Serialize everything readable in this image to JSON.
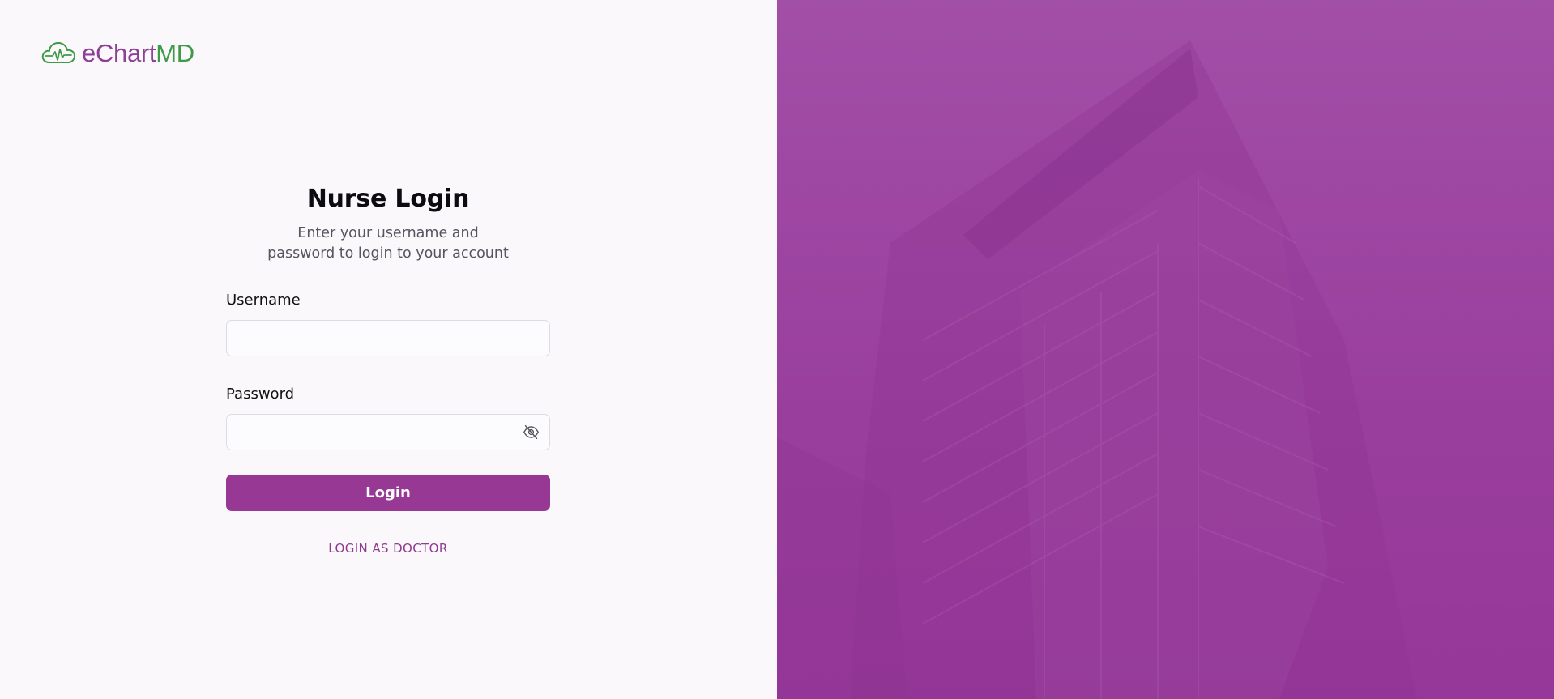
{
  "brand": {
    "name_prefix": "eChart",
    "name_suffix": "MD",
    "prefix_color": "#8e3f96",
    "suffix_color": "#3f9a48",
    "icon": "cloud-heartbeat-icon"
  },
  "login": {
    "title": "Nurse Login",
    "subtitle": "Enter your username and password to login to your account",
    "username_label": "Username",
    "username_value": "",
    "password_label": "Password",
    "password_value": "",
    "password_toggle_icon": "eye-off-icon",
    "submit_label": "Login",
    "alt_login_label": "LOGIN AS DOCTOR",
    "accent_color": "#983895"
  },
  "hero": {
    "image": "hospital-building-photo",
    "overlay_color": "#9b41a0"
  }
}
